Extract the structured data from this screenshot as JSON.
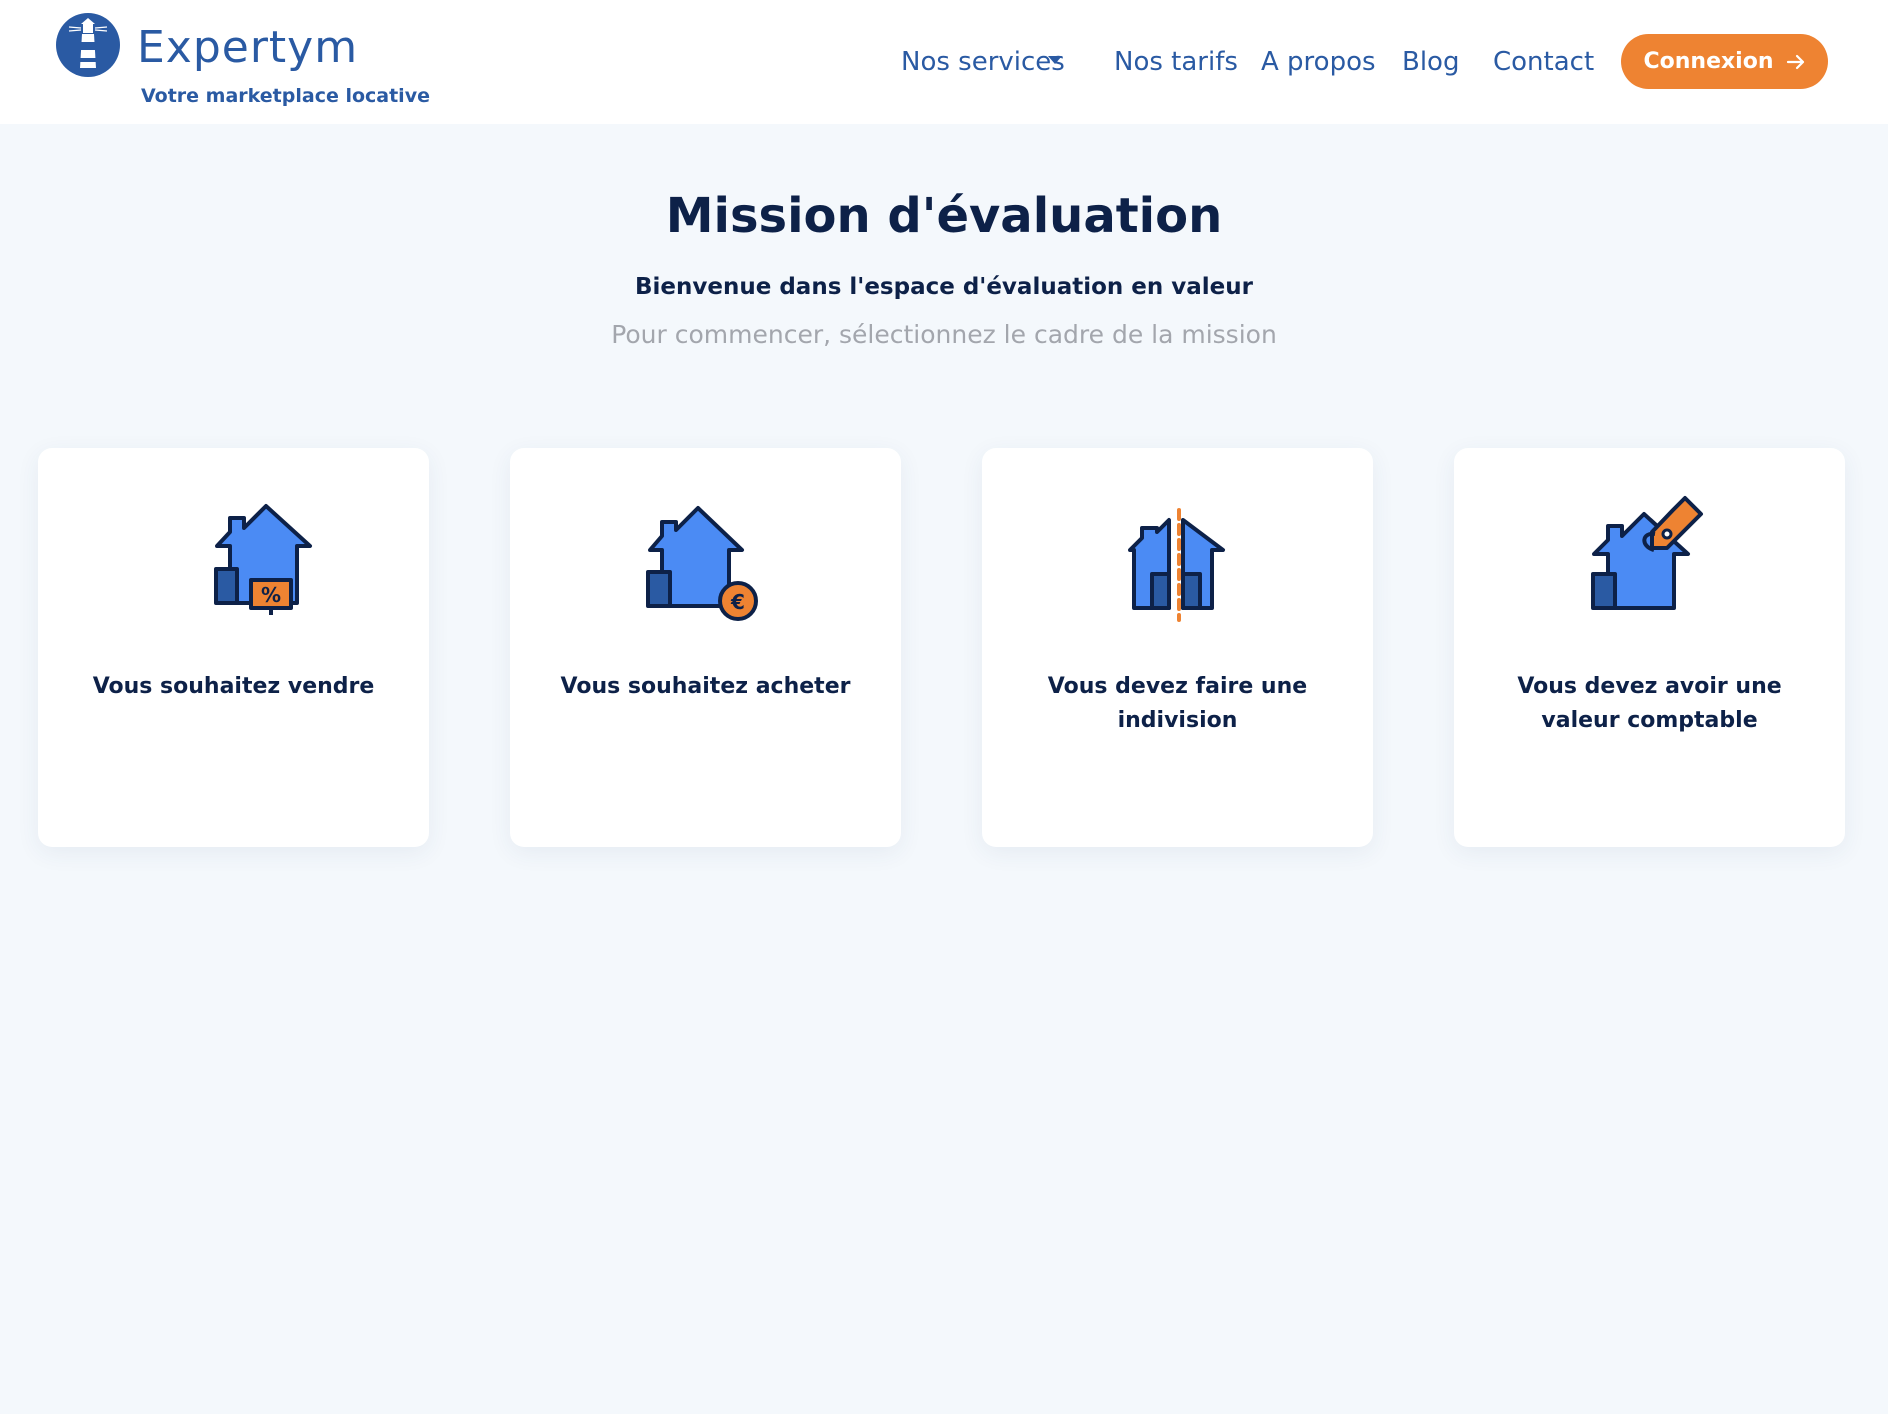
{
  "header": {
    "brand_name": "Expertym",
    "tagline": "Votre marketplace locative",
    "nav": {
      "services": "Nos services",
      "tarifs": "Nos tarifs",
      "apropos": "A propos",
      "blog": "Blog",
      "contact": "Contact"
    },
    "login_label": "Connexion"
  },
  "main": {
    "title": "Mission d'évaluation",
    "subtitle": "Bienvenue dans l'espace d'évaluation en valeur",
    "hint": "Pour commencer, sélectionnez le cadre de la mission"
  },
  "cards": [
    {
      "label": "Vous souhaitez vendre",
      "icon": "house-percent-sign-icon"
    },
    {
      "label": "Vous souhaitez acheter",
      "icon": "house-euro-coin-icon"
    },
    {
      "label": "Vous devez faire une indivision",
      "icon": "house-split-icon"
    },
    {
      "label": "Vous devez avoir une valeur comptable",
      "icon": "house-price-tag-icon"
    }
  ],
  "colors": {
    "brand_blue": "#2a5aa3",
    "dark_navy": "#0d2148",
    "accent_orange": "#ee8332",
    "house_blue": "#4b8bf4",
    "page_bg": "#f4f8fc"
  }
}
